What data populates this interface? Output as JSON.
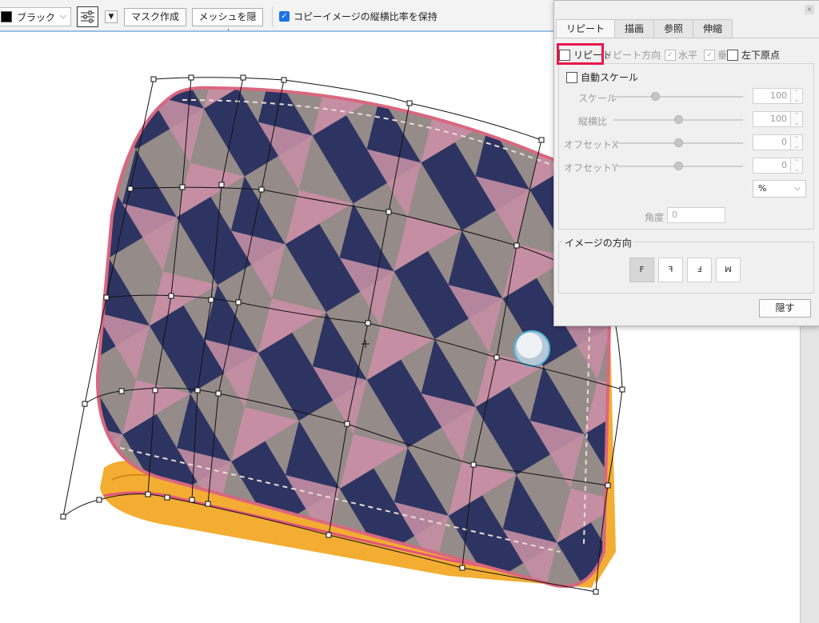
{
  "toolbar": {
    "color_label": "ブラック",
    "color_swatch": "#000000",
    "mask_button": "マスク作成",
    "mesh_button": "メッシュを隠す",
    "keep_ratio_label": "コピーイメージの縦横比率を保持",
    "keep_ratio_checked": true
  },
  "panel": {
    "tabs": [
      "リピート",
      "描画",
      "参照",
      "伸縮"
    ],
    "active_tab": "リピート",
    "repeat_label": "リピート",
    "repeat_direction_label": "リピート方向",
    "horizontal_label": "水平",
    "vertical_label": "垂直",
    "lower_left_origin_label": "左下原点",
    "auto_scale_label": "自動スケール",
    "sliders": [
      {
        "label": "スケール",
        "value": "100",
        "position": 0.32
      },
      {
        "label": "縦横比",
        "value": "100",
        "position": 0.5
      },
      {
        "label": "オフセットX",
        "value": "0",
        "position": 0.5
      },
      {
        "label": "オフセットY",
        "value": "0",
        "position": 0.5
      }
    ],
    "unit": "%",
    "angle_label": "角度",
    "angle_value": "0",
    "orientation_title": "イメージの方向",
    "orientation_glyphs": [
      "F",
      "ꟻ",
      "Ⅎ",
      "ꟽ"
    ],
    "hide_button": "隠す"
  },
  "colors": {
    "navy": "#2d3461",
    "taupe": "#958b88",
    "pink": "#c58ea3",
    "orange": "#f1a52a",
    "highlight": "#e8174c"
  }
}
